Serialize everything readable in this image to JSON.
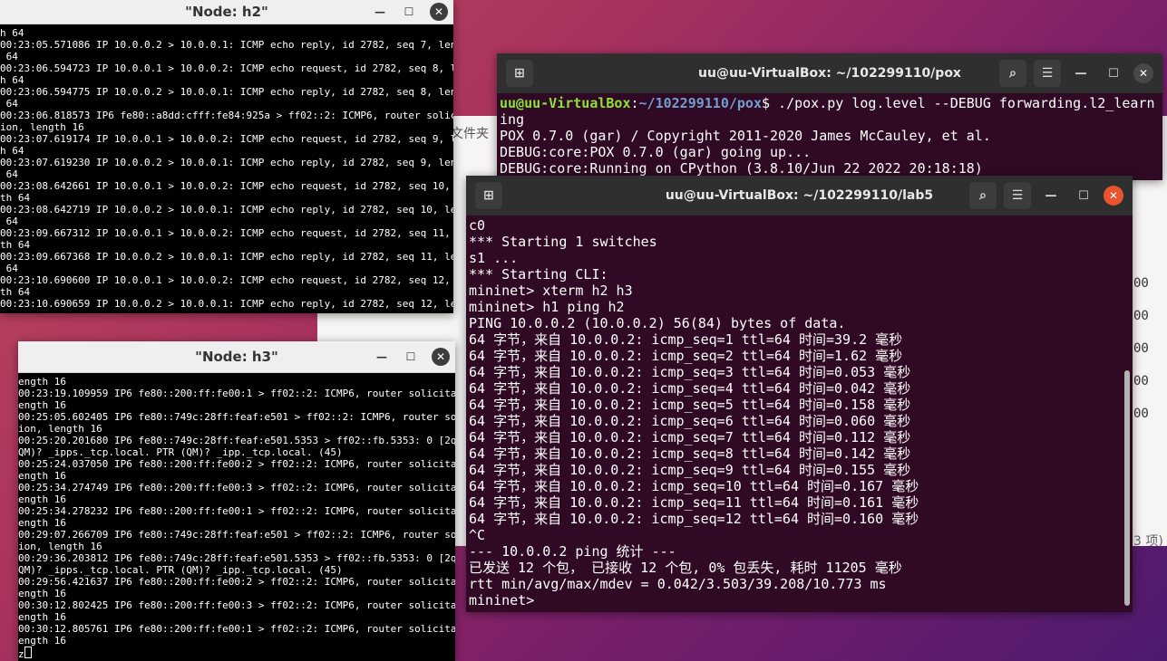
{
  "h2": {
    "title": "\"Node: h2\"",
    "lines": [
      "h 64",
      "00:23:05.571086 IP 10.0.0.2 > 10.0.0.1: ICMP echo reply, id 2782, seq 7, length",
      " 64",
      "00:23:06.594723 IP 10.0.0.1 > 10.0.0.2: ICMP echo request, id 2782, seq 8, lengt",
      "h 64",
      "00:23:06.594775 IP 10.0.0.2 > 10.0.0.1: ICMP echo reply, id 2782, seq 8, length",
      " 64",
      "00:23:06.818573 IP6 fe80::a8dd:cfff:fe84:925a > ff02::2: ICMP6, router solicitat",
      "ion, length 16",
      "00:23:07.619174 IP 10.0.0.1 > 10.0.0.2: ICMP echo request, id 2782, seq 9, lengt",
      "h 64",
      "00:23:07.619230 IP 10.0.0.2 > 10.0.0.1: ICMP echo reply, id 2782, seq 9, length",
      " 64",
      "00:23:08.642661 IP 10.0.0.1 > 10.0.0.2: ICMP echo request, id 2782, seq 10, leng",
      "th 64",
      "00:23:08.642719 IP 10.0.0.2 > 10.0.0.1: ICMP echo reply, id 2782, seq 10, length",
      " 64",
      "00:23:09.667312 IP 10.0.0.1 > 10.0.0.2: ICMP echo request, id 2782, seq 11, leng",
      "th 64",
      "00:23:09.667368 IP 10.0.0.2 > 10.0.0.1: ICMP echo reply, id 2782, seq 11, length",
      " 64",
      "00:23:10.690600 IP 10.0.0.1 > 10.0.0.2: ICMP echo request, id 2782, seq 12, leng",
      "th 64",
      "00:23:10.690659 IP 10.0.0.2 > 10.0.0.1: ICMP echo reply, id 2782, seq 12, length"
    ]
  },
  "h3": {
    "title": "\"Node: h3\"",
    "lines": [
      "ength 16",
      "00:23:19.109959 IP6 fe80::200:ff:fe00:1 > ff02::2: ICMP6, router solicitation, l",
      "ength 16",
      "00:25:05.602405 IP6 fe80::749c:28ff:feaf:e501 > ff02::2: ICMP6, router solicitat",
      "ion, length 16",
      "00:25:20.201680 IP6 fe80::749c:28ff:feaf:e501.5353 > ff02::fb.5353: 0 [2q] PTR (",
      "QM)? _ipps._tcp.local. PTR (QM)? _ipp._tcp.local. (45)",
      "00:25:24.037050 IP6 fe80::200:ff:fe00:2 > ff02::2: ICMP6, router solicitation, l",
      "ength 16",
      "00:25:34.274749 IP6 fe80::200:ff:fe00:3 > ff02::2: ICMP6, router solicitation, l",
      "ength 16",
      "00:25:34.278232 IP6 fe80::200:ff:fe00:1 > ff02::2: ICMP6, router solicitation, l",
      "ength 16",
      "00:29:07.266709 IP6 fe80::749c:28ff:feaf:e501 > ff02::2: ICMP6, router solicitat",
      "ion, length 16",
      "00:29:36.203812 IP6 fe80::749c:28ff:feaf:e501.5353 > ff02::fb.5353: 0 [2q] PTR (",
      "QM)? _ipps._tcp.local. PTR (QM)? _ipp._tcp.local. (45)",
      "00:29:56.421637 IP6 fe80::200:ff:fe00:2 > ff02::2: ICMP6, router solicitation, l",
      "ength 16",
      "00:30:12.802425 IP6 fe80::200:ff:fe00:3 > ff02::2: ICMP6, router solicitation, l",
      "ength 16",
      "00:30:12.805761 IP6 fe80::200:ff:fe00:1 > ff02::2: ICMP6, router solicitation, l",
      "ength 16"
    ],
    "prompt": "z"
  },
  "pox": {
    "title": "uu@uu-VirtualBox: ~/102299110/pox",
    "prompt_user": "uu@uu-VirtualBox",
    "prompt_colon": ":",
    "prompt_path": "~/102299110/pox",
    "prompt_cmd": "$ ./pox.py log.level --DEBUG forwarding.l2_learn",
    "lines": [
      "ing",
      "POX 0.7.0 (gar) / Copyright 2011-2020 James McCauley, et al.",
      "DEBUG:core:POX 0.7.0 (gar) going up...",
      "DEBUG:core:Running on CPython (3.8.10/Jun 22 2022 20:18:18)"
    ]
  },
  "lab5": {
    "title": "uu@uu-VirtualBox: ~/102299110/lab5",
    "lines": [
      "c0",
      "*** Starting 1 switches",
      "s1 ...",
      "*** Starting CLI:",
      "mininet> xterm h2 h3",
      "mininet> h1 ping h2",
      "PING 10.0.0.2 (10.0.0.2) 56(84) bytes of data.",
      "64 字节，来自 10.0.0.2: icmp_seq=1 ttl=64 时间=39.2 毫秒",
      "64 字节，来自 10.0.0.2: icmp_seq=2 ttl=64 时间=1.62 毫秒",
      "64 字节，来自 10.0.0.2: icmp_seq=3 ttl=64 时间=0.053 毫秒",
      "64 字节，来自 10.0.0.2: icmp_seq=4 ttl=64 时间=0.042 毫秒",
      "64 字节，来自 10.0.0.2: icmp_seq=5 ttl=64 时间=0.158 毫秒",
      "64 字节，来自 10.0.0.2: icmp_seq=6 ttl=64 时间=0.060 毫秒",
      "64 字节，来自 10.0.0.2: icmp_seq=7 ttl=64 时间=0.112 毫秒",
      "64 字节，来自 10.0.0.2: icmp_seq=8 ttl=64 时间=0.142 毫秒",
      "64 字节，来自 10.0.0.2: icmp_seq=9 ttl=64 时间=0.155 毫秒",
      "64 字节，来自 10.0.0.2: icmp_seq=10 ttl=64 时间=0.167 毫秒",
      "64 字节，来自 10.0.0.2: icmp_seq=11 ttl=64 时间=0.161 毫秒",
      "64 字节，来自 10.0.0.2: icmp_seq=12 ttl=64 时间=0.160 毫秒",
      "^C",
      "--- 10.0.0.2 ping 统计 ---",
      "已发送 12 个包， 已接收 12 个包, 0% 包丢失, 耗时 11205 毫秒",
      "rtt min/avg/max/mdev = 0.042/3.503/39.208/10.773 ms",
      "mininet> "
    ]
  },
  "filemanager": {
    "label_folder": "文件夹",
    "item_count": "3 项)",
    "partial_values": [
      "00",
      "00",
      "00",
      "00",
      "00"
    ]
  },
  "icons": {
    "minimize": "—",
    "maximize": "☐",
    "close": "✕",
    "newtab": "⊞",
    "search": "⌕",
    "menu": "☰"
  }
}
